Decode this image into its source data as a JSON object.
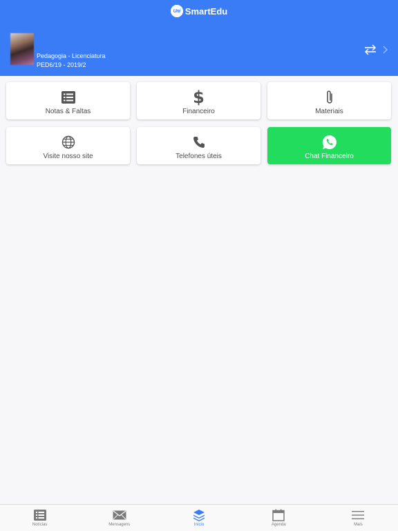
{
  "header": {
    "logo_text": "Uni",
    "app_name": "SmartEdu",
    "course_name": "Pedagogia - Licenciatura",
    "course_period": "PED6/19 - 2019/2"
  },
  "tiles": [
    {
      "label": "Notas & Faltas",
      "icon": "list-icon"
    },
    {
      "label": "Financeiro",
      "icon": "dollar-icon"
    },
    {
      "label": "Materiais",
      "icon": "paperclip-icon"
    },
    {
      "label": "Visite nosso site",
      "icon": "globe-icon"
    },
    {
      "label": "Telefones úteis",
      "icon": "phone-icon"
    },
    {
      "label": "Chat Financeiro",
      "icon": "whatsapp-icon",
      "color": "#22dc5e"
    }
  ],
  "tabbar": [
    {
      "label": "Notícias",
      "icon": "news-icon"
    },
    {
      "label": "Mensagens",
      "icon": "envelope-icon"
    },
    {
      "label": "Início",
      "icon": "layers-icon",
      "active": true
    },
    {
      "label": "Agenda",
      "icon": "calendar-icon"
    },
    {
      "label": "Mais",
      "icon": "menu-icon"
    }
  ],
  "colors": {
    "accent": "#3a7cf6",
    "whatsapp": "#22dc5e"
  }
}
